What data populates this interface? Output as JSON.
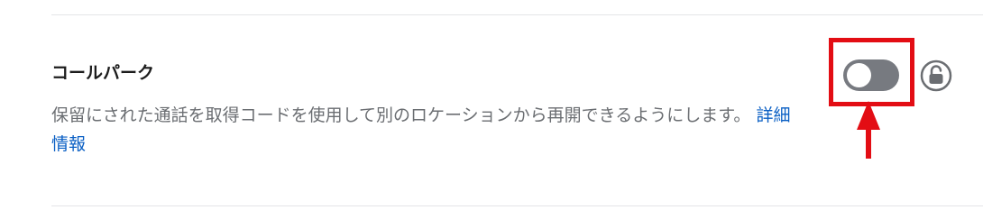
{
  "setting": {
    "title": "コールパーク",
    "description": "保留にされた通話を取得コードを使用して別のロケーションから再開できるようにします。",
    "link_label": "詳細情報",
    "toggle_state": "off",
    "lock_state": "unlocked"
  },
  "colors": {
    "title": "#1c1c1c",
    "description": "#6b6e72",
    "link": "#0a5fc4",
    "toggle_track": "#777a80",
    "toggle_knob": "#ffffff",
    "lock_icon": "#6b6e72",
    "highlight": "#e30d14",
    "divider": "#e4e5e7"
  },
  "icons": {
    "lock": "unlocked-padlock-icon",
    "arrow": "red-up-arrow-icon"
  }
}
